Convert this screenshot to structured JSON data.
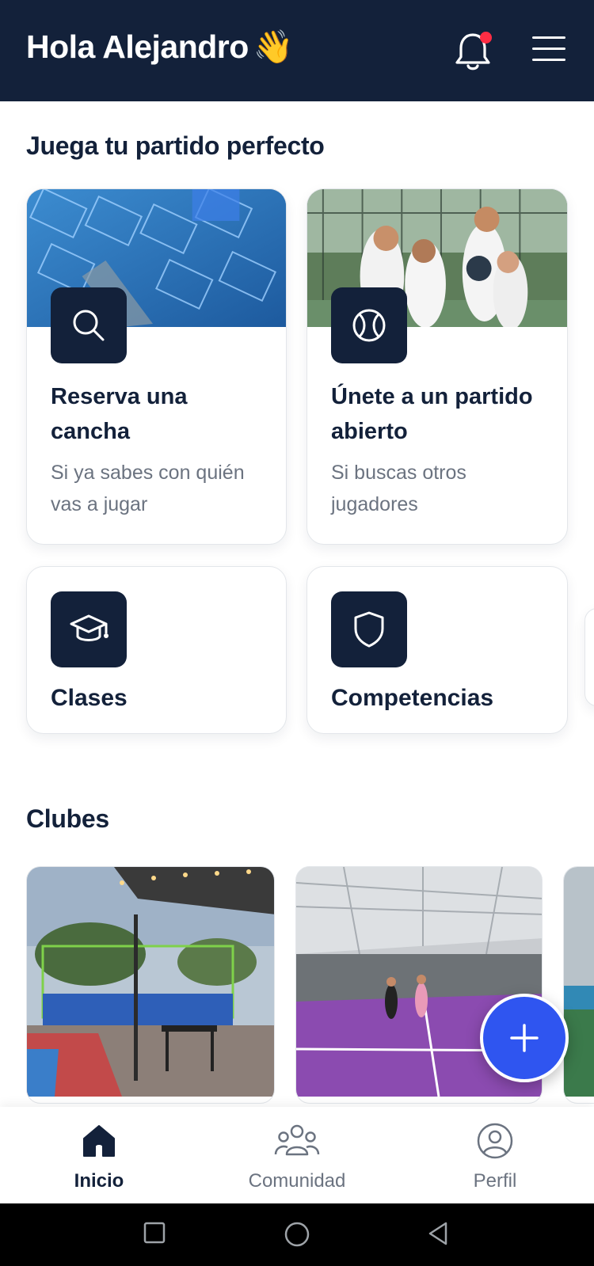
{
  "header": {
    "greeting": "Hola Alejandro",
    "wave_emoji": "👋",
    "notification_icon": "bell-icon",
    "notification_badge_color": "#ff2d44",
    "menu_icon": "hamburger-menu-icon",
    "background_color": "#13213a"
  },
  "play_section": {
    "title": "Juega tu partido perfecto",
    "cards": [
      {
        "title": "Reserva una cancha",
        "title_line1": "Reserva una",
        "title_line2": "cancha",
        "subtitle_line1": "Si ya sabes con quién",
        "subtitle_line2": "vas a jugar",
        "icon": "search-icon"
      },
      {
        "title": "Únete a un partido abierto",
        "title_line1": "Únete a un partido",
        "title_line2": "abierto",
        "subtitle_line1": "Si buscas otros",
        "subtitle_line2": "jugadores",
        "icon": "ball-icon"
      },
      {
        "title": "Clases",
        "icon": "graduation-cap-icon"
      },
      {
        "title": "Competencias",
        "icon": "shield-icon"
      }
    ]
  },
  "clubs_section": {
    "title": "Clubes"
  },
  "fab": {
    "icon": "plus-icon",
    "color": "#2f55f0"
  },
  "bottom_nav": {
    "items": [
      {
        "label": "Inicio",
        "icon": "home-icon",
        "active": true
      },
      {
        "label": "Comunidad",
        "icon": "community-icon",
        "active": false
      },
      {
        "label": "Perfil",
        "icon": "profile-icon",
        "active": false
      }
    ]
  },
  "system_nav": {
    "buttons": [
      "recents-icon",
      "home-circle-icon",
      "back-icon"
    ]
  }
}
